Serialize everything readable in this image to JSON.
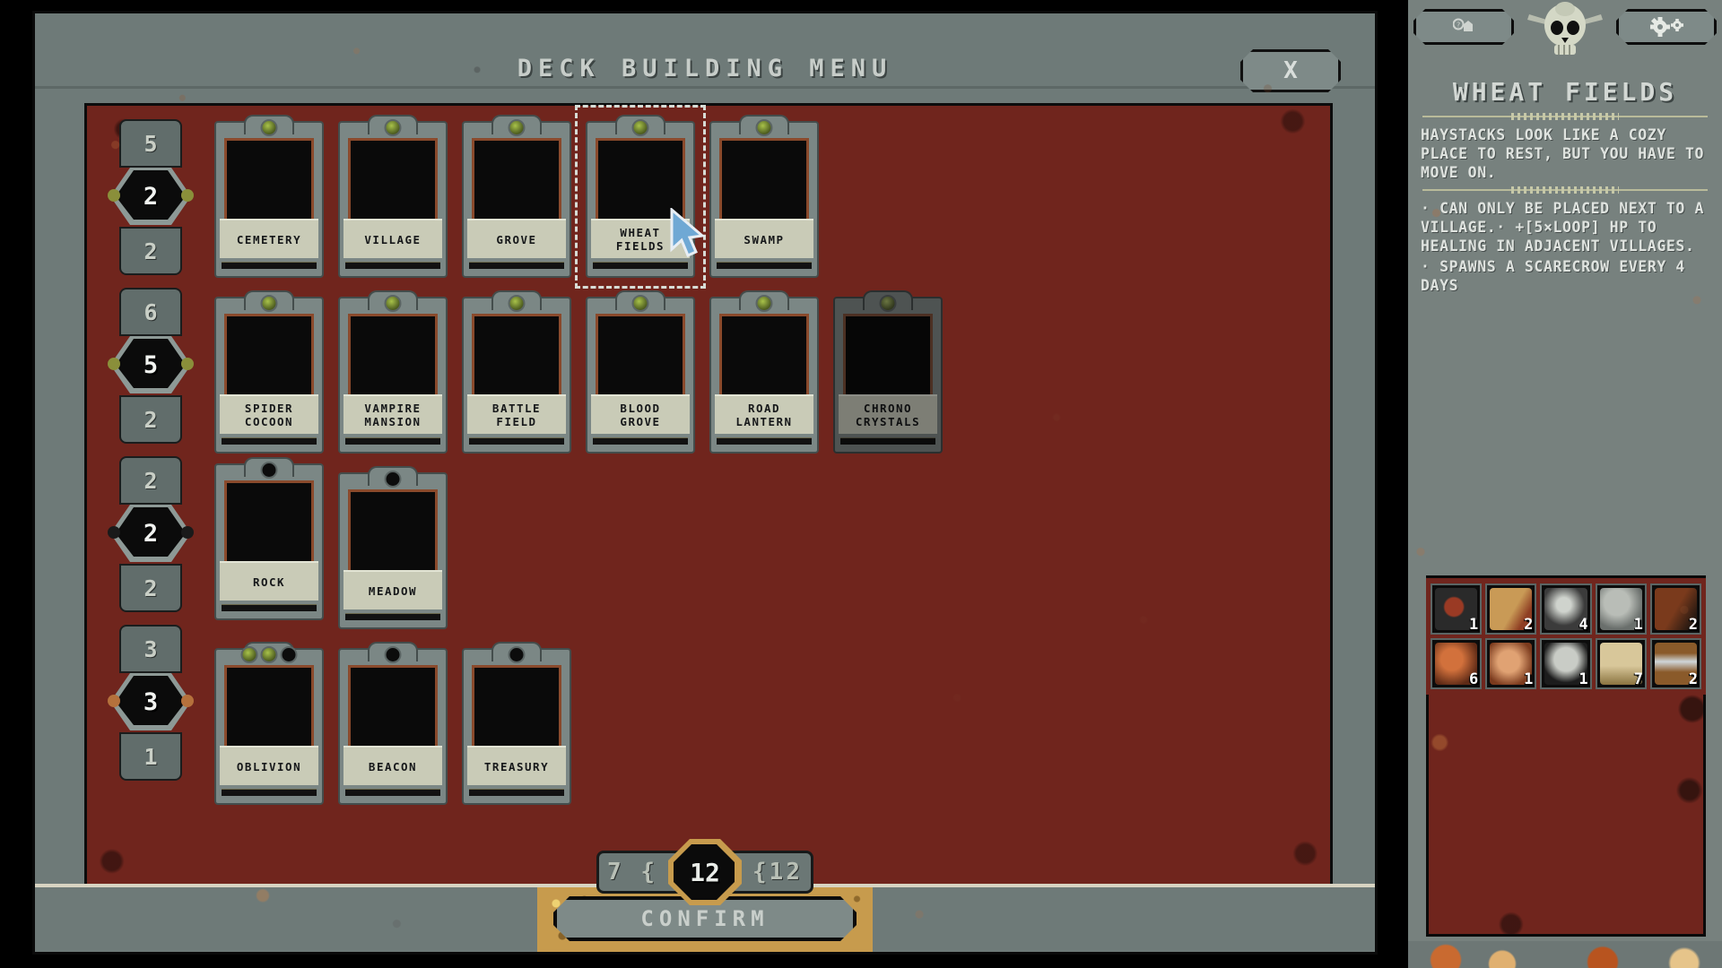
{
  "window": {
    "title": "DECK BUILDING MENU",
    "close_label": "X",
    "confirm_label": "CONFIRM"
  },
  "deck_counter": {
    "left": "7 {",
    "center": "12",
    "right": "{12"
  },
  "rail_groups": [
    {
      "top": "5",
      "gem": "2",
      "bottom": "2",
      "stud_color": "#8a8f3a"
    },
    {
      "top": "6",
      "gem": "5",
      "bottom": "2",
      "stud_color": "#8a8f3a"
    },
    {
      "top": "2",
      "gem": "2",
      "bottom": "2",
      "stud_color": "#1a1a1a"
    },
    {
      "top": "3",
      "gem": "3",
      "bottom": "1",
      "stud_color": "#b5713c"
    }
  ],
  "card_rows": [
    [
      {
        "name": "CEMETERY",
        "art": "t-cemetery",
        "gems": [
          "green"
        ],
        "state": "normal"
      },
      {
        "name": "VILLAGE",
        "art": "t-village",
        "gems": [
          "green"
        ],
        "state": "normal"
      },
      {
        "name": "GROVE",
        "art": "t-grove",
        "gems": [
          "green"
        ],
        "state": "normal"
      },
      {
        "name": "WHEAT FIELDS",
        "art": "t-wheat",
        "gems": [
          "green"
        ],
        "state": "selected"
      },
      {
        "name": "SWAMP",
        "art": "t-swamp",
        "gems": [
          "green"
        ],
        "state": "normal"
      }
    ],
    [
      {
        "name": "SPIDER COCOON",
        "art": "t-spider",
        "gems": [
          "green"
        ],
        "state": "normal"
      },
      {
        "name": "VAMPIRE MANSION",
        "art": "t-vampire",
        "gems": [
          "green"
        ],
        "state": "normal"
      },
      {
        "name": "BATTLE FIELD",
        "art": "t-battle",
        "gems": [
          "green"
        ],
        "state": "normal"
      },
      {
        "name": "BLOOD GROVE",
        "art": "t-bloodgrove",
        "gems": [
          "green"
        ],
        "state": "normal"
      },
      {
        "name": "ROAD LANTERN",
        "art": "t-lantern",
        "gems": [
          "green"
        ],
        "state": "normal"
      },
      {
        "name": "CHRONO CRYSTALS",
        "art": "t-chrono",
        "gems": [
          "green"
        ],
        "state": "disabled"
      }
    ],
    [
      {
        "name": "ROCK",
        "art": "t-rock",
        "gems": [
          "dark"
        ],
        "state": "raised"
      },
      {
        "name": "MEADOW",
        "art": "t-meadow",
        "gems": [
          "dark"
        ],
        "state": "normal"
      }
    ],
    [
      {
        "name": "OBLIVION",
        "art": "t-oblivion",
        "gems": [
          "green",
          "green",
          "dark"
        ],
        "state": "normal"
      },
      {
        "name": "BEACON",
        "art": "t-beacon",
        "gems": [
          "dark"
        ],
        "state": "normal"
      },
      {
        "name": "TREASURY",
        "art": "t-treasury",
        "gems": [
          "dark"
        ],
        "state": "normal"
      }
    ]
  ],
  "sidebar": {
    "title": "WHEAT FIELDS",
    "description": "HAYSTACKS LOOK LIKE A COZY PLACE TO REST, BUT YOU HAVE TO MOVE ON.",
    "effects": [
      "CAN ONLY BE PLACED NEXT TO A VILLAGE.· +[5×LOOP] HP TO HEALING IN ADJACENT VILLAGES.",
      "SPAWNS A SCARECROW EVERY 4 DAYS"
    ],
    "hud": {
      "help_icon": "help-building-icon",
      "settings_icon": "gear-icon",
      "skull_icon": "skull-ornament-icon"
    },
    "inventory": [
      {
        "icon": "i-thorn",
        "qty": "1"
      },
      {
        "icon": "i-wing",
        "qty": "2"
      },
      {
        "icon": "i-orb",
        "qty": "4"
      },
      {
        "icon": "i-stone",
        "qty": "1"
      },
      {
        "icon": "i-wood",
        "qty": "2"
      },
      {
        "icon": "i-meat",
        "qty": "6"
      },
      {
        "icon": "i-brain",
        "qty": "1"
      },
      {
        "icon": "i-skull",
        "qty": "1"
      },
      {
        "icon": "i-scroll",
        "qty": "7"
      },
      {
        "icon": "i-book",
        "qty": "2"
      }
    ]
  },
  "colors": {
    "panel": "#6e7a78",
    "playfield": "#70251d",
    "gold": "#c79b4d",
    "text": "#c7cdc9"
  }
}
